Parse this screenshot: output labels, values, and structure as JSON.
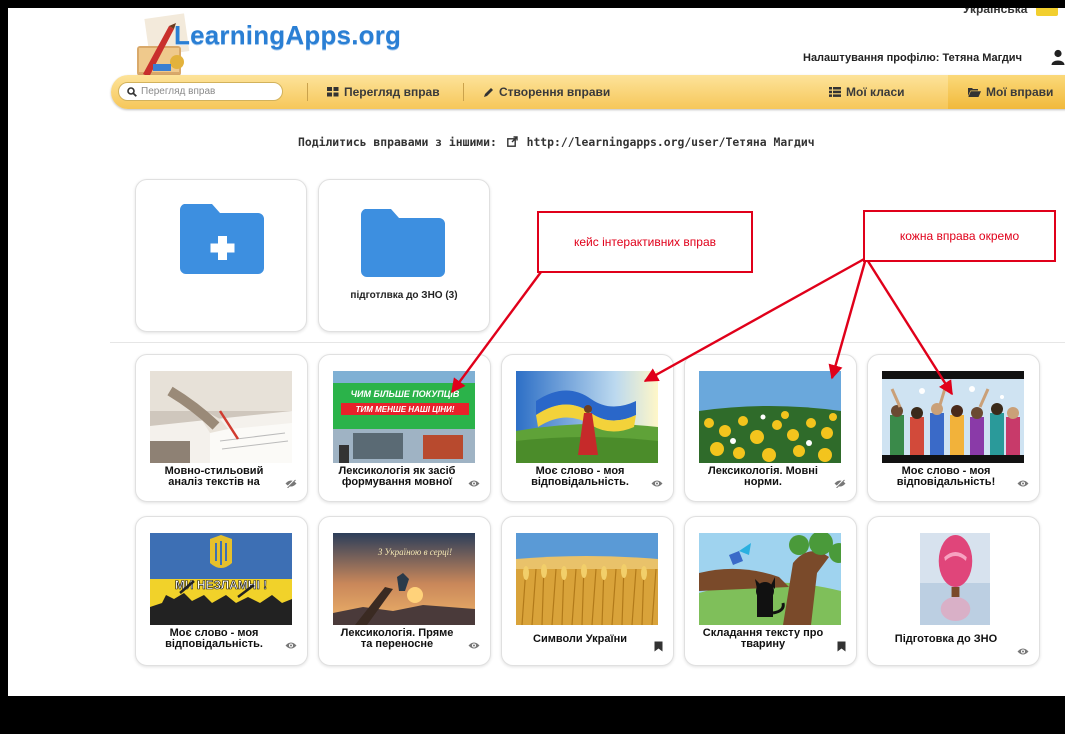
{
  "header": {
    "language": "Українська",
    "logo_text": "LearningApps.org",
    "profile_text": "Налаштування профілю: Тетяна Магдич"
  },
  "nav": {
    "search_placeholder": "Перегляд вправ",
    "browse_label": "Перегляд вправ",
    "create_label": "Створення вправи",
    "classes_label": "Мої класи",
    "my_exercises_label": "Мої вправи"
  },
  "share": {
    "text": "Поділитись вправами з іншими:",
    "url": "http://learningapps.org/user/Тетяна Магдич"
  },
  "folders": [
    {
      "label": ""
    },
    {
      "label": "підготлвка до ЗНО (3)"
    }
  ],
  "exercises": [
    {
      "title": "Мовно-стильовий аналіз текстів на",
      "icon": "eye-slash-icon"
    },
    {
      "title": "Лексикологія як засіб формування мовної",
      "icon": "eye-icon"
    },
    {
      "title": "Моє слово - моя відповідальність.",
      "icon": "eye-icon"
    },
    {
      "title": "Лексикологія. Мовні норми.",
      "icon": "eye-slash-icon"
    },
    {
      "title": "Моє слово - моя відповідальність!",
      "icon": "eye-icon"
    },
    {
      "title": "Моє слово - моя відповідальність.",
      "icon": "eye-icon"
    },
    {
      "title": "Лексикологія. Пряме та переносне",
      "icon": "eye-icon"
    },
    {
      "title": "Символи України",
      "icon": "bookmark-icon"
    },
    {
      "title": "Складання тексту про тварину",
      "icon": "bookmark-icon"
    },
    {
      "title": "Підготовка до ЗНО",
      "icon": "eye-icon"
    }
  ],
  "thumb_text": {
    "banner_line1": "ЧИМ БІЛЬШЕ ПОКУПЦІВ",
    "banner_line2": "ТИМ МЕНШЕ НАШІ ЦІНИ!",
    "unbreakable": "МИ НЕЗЛАМНІ !",
    "in_heart": "З Україною в серці!"
  },
  "annotations": {
    "case_note": "кейс інтерактивних вправ",
    "each_note": "кожна вправа окремо"
  },
  "colors": {
    "nav_bar": "#f6c75a",
    "folder_blue": "#3d8fe0",
    "annotation_red": "#e0001a",
    "logo_blue": "#2a7fd4"
  }
}
